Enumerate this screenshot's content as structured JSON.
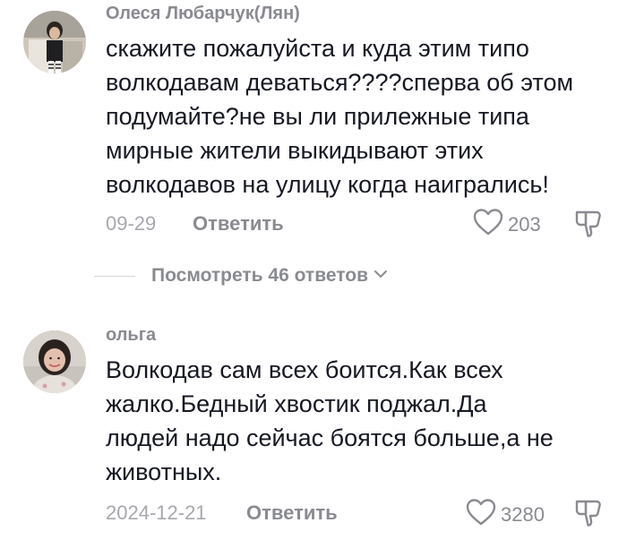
{
  "comments": [
    {
      "username": "Олеся Любарчук(Лян)",
      "text": "скажите пожалуйста и куда этим типо волкодавам деваться????сперва об этом подумайте?не вы ли прилежные типа мирные жители выкидывают этих волкодавов на улицу когда наигрались!",
      "date": "09-29",
      "reply_label": "Ответить",
      "likes": "203"
    },
    {
      "username": "ольга",
      "text": "Волкодав сам всех боится.Как всех жалко.Бедный хвостик поджал.Да людей надо сейчас боятся больше,а не животных.",
      "date": "2024-12-21",
      "reply_label": "Ответить",
      "likes": "3280"
    }
  ],
  "view_replies_label": "Посмотреть 46 ответов",
  "icons": {
    "like": "heart-outline-icon",
    "dislike": "thumbs-down-icon",
    "expand": "chevron-down-icon"
  },
  "colors": {
    "text": "#161823",
    "muted": "#8a8b91",
    "date": "#a7a8ad"
  }
}
